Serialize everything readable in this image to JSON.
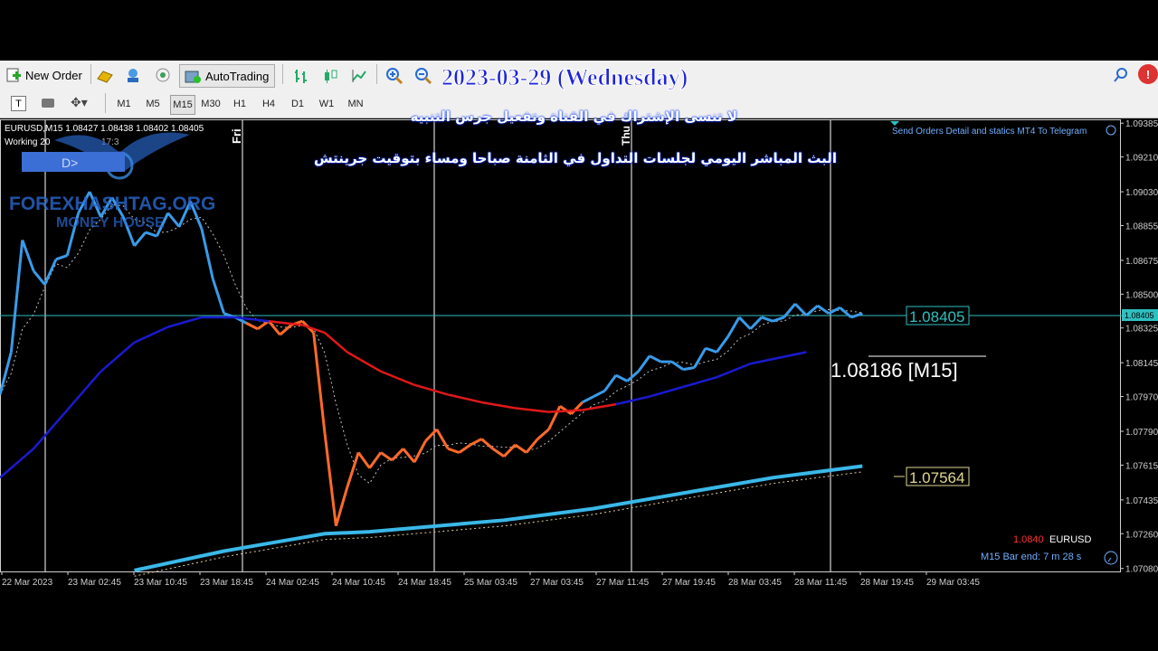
{
  "toolbar": {
    "new_order": "New Order",
    "auto_trading": "AutoTrading",
    "timeframes": [
      "M1",
      "M5",
      "M15",
      "M30",
      "H1",
      "H4",
      "D1",
      "W1",
      "MN"
    ],
    "active_timeframe": "M15"
  },
  "overlay": {
    "date": "2023-03-29 (Wednesday)",
    "line1": "لا تنسى الإشتراك في القناة وتفعيل جرس التنبيه",
    "line2": "البث المباشر اليومي لجلسات التداول في الثامنة صباحا ومساء بتوقيت جرينتش"
  },
  "chart": {
    "header": "EURUSD,M15  1.08427 1.08438 1.08402 1.08405",
    "status": "Working 20",
    "clock": "17:3",
    "logo_button": "D>",
    "watermark1": "FOREXHASHTAG.ORG",
    "watermark2": "MONEY HOUSE",
    "indicator_title": "Send Orders Detail and statics MT4 To Telegram",
    "fri_label": "Fri",
    "thu_label": "Thu",
    "price_box1": "1.08405",
    "price_box2": "1.07564",
    "ma_label": "1.08186 [M15]",
    "bid_price": "1.0840",
    "symbol": "EURUSD",
    "bar_end": "M15 Bar end: 7 m 28 s",
    "current_price_tag": "1.08405"
  },
  "colors": {
    "grid": "#ffffff",
    "bull": "#3a9be8",
    "bear": "#ff6a2a",
    "ma_blue": "#1a1ad0",
    "ma_red": "#e01818",
    "ma_cyan": "#3ab8e8",
    "hline": "#30c0c0"
  },
  "chart_data": {
    "type": "line",
    "symbol": "EURUSD",
    "timeframe": "M15",
    "y_ticks": [
      "1.09385",
      "1.09210",
      "1.09030",
      "1.08855",
      "1.08675",
      "1.08500",
      "1.08325",
      "1.08145",
      "1.07970",
      "1.07790",
      "1.07615",
      "1.07435",
      "1.07260",
      "1.07080"
    ],
    "x_ticks": [
      "22 Mar 2023",
      "23 Mar 02:45",
      "23 Mar 10:45",
      "23 Mar 18:45",
      "24 Mar 02:45",
      "24 Mar 10:45",
      "24 Mar 18:45",
      "25 Mar 03:45",
      "27 Mar 03:45",
      "27 Mar 11:45",
      "27 Mar 19:45",
      "28 Mar 03:45",
      "28 Mar 11:45",
      "28 Mar 19:45",
      "29 Mar 03:45"
    ],
    "ylim": [
      1.0706,
      1.094
    ],
    "price_path": [
      [
        0,
        1.0798
      ],
      [
        0.01,
        1.082
      ],
      [
        0.02,
        1.0878
      ],
      [
        0.03,
        1.0862
      ],
      [
        0.04,
        1.0855
      ],
      [
        0.05,
        1.0868
      ],
      [
        0.06,
        1.087
      ],
      [
        0.07,
        1.0892
      ],
      [
        0.08,
        1.0903
      ],
      [
        0.09,
        1.089
      ],
      [
        0.1,
        1.09
      ],
      [
        0.11,
        1.089
      ],
      [
        0.12,
        1.0875
      ],
      [
        0.13,
        1.0882
      ],
      [
        0.14,
        1.088
      ],
      [
        0.15,
        1.0892
      ],
      [
        0.16,
        1.0885
      ],
      [
        0.17,
        1.0898
      ],
      [
        0.18,
        1.0884
      ],
      [
        0.19,
        1.0858
      ],
      [
        0.2,
        1.084
      ],
      [
        0.21,
        1.0838
      ],
      [
        0.22,
        1.0835
      ],
      [
        0.23,
        1.0832
      ],
      [
        0.24,
        1.0836
      ],
      [
        0.25,
        1.0829
      ],
      [
        0.26,
        1.0834
      ],
      [
        0.27,
        1.0836
      ],
      [
        0.28,
        1.083
      ],
      [
        0.29,
        1.0778
      ],
      [
        0.3,
        1.073
      ],
      [
        0.31,
        1.075
      ],
      [
        0.32,
        1.0768
      ],
      [
        0.33,
        1.076
      ],
      [
        0.34,
        1.0768
      ],
      [
        0.35,
        1.0764
      ],
      [
        0.36,
        1.077
      ],
      [
        0.37,
        1.0763
      ],
      [
        0.38,
        1.0774
      ],
      [
        0.39,
        1.078
      ],
      [
        0.4,
        1.077
      ],
      [
        0.41,
        1.0768
      ],
      [
        0.42,
        1.0772
      ],
      [
        0.43,
        1.0775
      ],
      [
        0.44,
        1.077
      ],
      [
        0.45,
        1.0766
      ],
      [
        0.46,
        1.0772
      ],
      [
        0.47,
        1.0768
      ],
      [
        0.48,
        1.0775
      ],
      [
        0.49,
        1.078
      ],
      [
        0.5,
        1.0792
      ],
      [
        0.51,
        1.0788
      ],
      [
        0.52,
        1.0794
      ],
      [
        0.53,
        1.0797
      ],
      [
        0.54,
        1.08
      ],
      [
        0.55,
        1.0808
      ],
      [
        0.56,
        1.0805
      ],
      [
        0.57,
        1.081
      ],
      [
        0.58,
        1.0818
      ],
      [
        0.59,
        1.0815
      ],
      [
        0.6,
        1.0815
      ],
      [
        0.61,
        1.0811
      ],
      [
        0.62,
        1.0812
      ],
      [
        0.63,
        1.0822
      ],
      [
        0.64,
        1.082
      ],
      [
        0.65,
        1.0828
      ],
      [
        0.66,
        1.0838
      ],
      [
        0.67,
        1.0832
      ],
      [
        0.68,
        1.0838
      ],
      [
        0.69,
        1.0836
      ],
      [
        0.7,
        1.0838
      ],
      [
        0.71,
        1.0845
      ],
      [
        0.72,
        1.0839
      ],
      [
        0.73,
        1.0844
      ],
      [
        0.74,
        1.084
      ],
      [
        0.75,
        1.0843
      ],
      [
        0.76,
        1.0838
      ],
      [
        0.77,
        1.084
      ]
    ],
    "ma_main": [
      [
        0,
        1.0755
      ],
      [
        0.03,
        1.077
      ],
      [
        0.06,
        1.079
      ],
      [
        0.09,
        1.081
      ],
      [
        0.12,
        1.0825
      ],
      [
        0.15,
        1.0833
      ],
      [
        0.18,
        1.0838
      ],
      [
        0.21,
        1.0838
      ],
      [
        0.24,
        1.0836
      ],
      [
        0.27,
        1.0834
      ],
      [
        0.29,
        1.083
      ],
      [
        0.31,
        1.082
      ],
      [
        0.34,
        1.081
      ],
      [
        0.37,
        1.0803
      ],
      [
        0.4,
        1.0798
      ],
      [
        0.43,
        1.0794
      ],
      [
        0.46,
        1.0791
      ],
      [
        0.49,
        1.0789
      ],
      [
        0.52,
        1.079
      ],
      [
        0.55,
        1.0793
      ],
      [
        0.58,
        1.0797
      ],
      [
        0.61,
        1.0802
      ],
      [
        0.64,
        1.0807
      ],
      [
        0.67,
        1.0814
      ],
      [
        0.72,
        1.082
      ]
    ],
    "ma_slow": [
      [
        0.12,
        1.0707
      ],
      [
        0.16,
        1.0712
      ],
      [
        0.2,
        1.0717
      ],
      [
        0.24,
        1.0721
      ],
      [
        0.29,
        1.0726
      ],
      [
        0.33,
        1.0727
      ],
      [
        0.37,
        1.0729
      ],
      [
        0.41,
        1.0731
      ],
      [
        0.45,
        1.0733
      ],
      [
        0.49,
        1.0736
      ],
      [
        0.53,
        1.0739
      ],
      [
        0.57,
        1.0743
      ],
      [
        0.61,
        1.0747
      ],
      [
        0.65,
        1.0751
      ],
      [
        0.69,
        1.0755
      ],
      [
        0.73,
        1.0758
      ],
      [
        0.77,
        1.0761
      ]
    ]
  }
}
